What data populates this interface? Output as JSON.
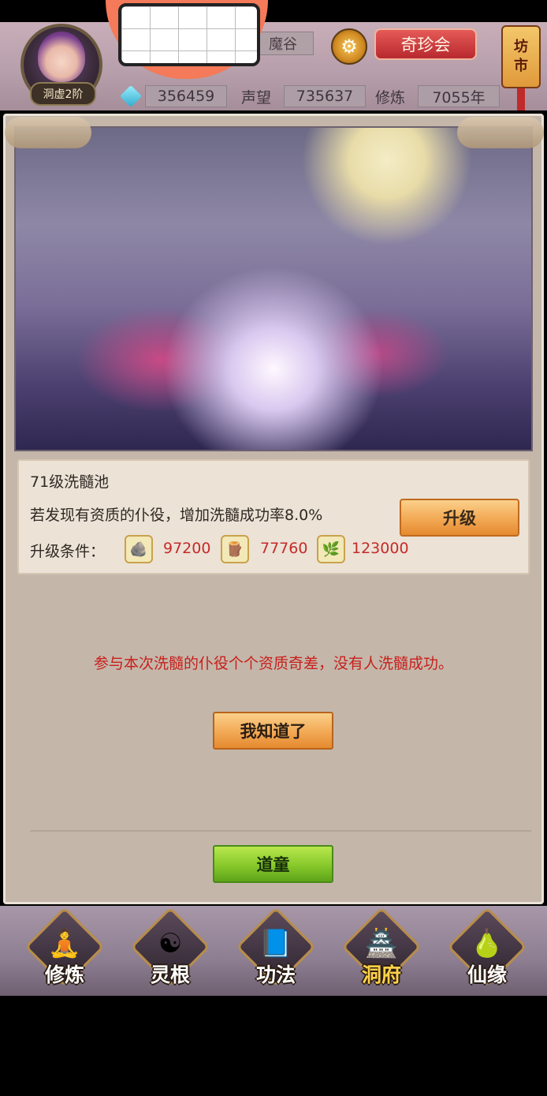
{
  "header": {
    "rank": "洞虚2阶",
    "place_suffix": "魔谷",
    "treasure_button": "奇珍会",
    "market_button": [
      "坊",
      "市"
    ],
    "spirit_stones": "356459",
    "reputation_label": "声望",
    "reputation": "735637",
    "cultivation_label": "修炼",
    "cultivation": "7055年"
  },
  "panel": {
    "pool_title": "71级洗髓池",
    "pool_desc": "若发现有资质的仆役，增加洗髓成功率8.0%",
    "upgrade_button": "升级",
    "requirement_label": "升级条件：",
    "resources": [
      {
        "icon": "ore-icon",
        "value": "97200"
      },
      {
        "icon": "wood-icon",
        "value": "77760"
      },
      {
        "icon": "herb-icon",
        "value": "123000"
      }
    ],
    "result_message": "参与本次洗髓的仆役个个资质奇差，没有人洗髓成功。",
    "ok_button": "我知道了",
    "taoist_button": "道童"
  },
  "nav": [
    {
      "label": "修炼",
      "icon": "hooded-cultivator-icon",
      "active": false
    },
    {
      "label": "灵根",
      "icon": "yin-yang-root-icon",
      "active": false
    },
    {
      "label": "功法",
      "icon": "scripture-book-icon",
      "active": false
    },
    {
      "label": "洞府",
      "icon": "cave-palace-icon",
      "active": true
    },
    {
      "label": "仙缘",
      "icon": "gourd-icon",
      "active": false
    }
  ],
  "colors": {
    "accent_red": "#c8201c",
    "button_orange": "#f2a854",
    "button_green": "#86c82a",
    "nav_active": "#ffd24a"
  }
}
